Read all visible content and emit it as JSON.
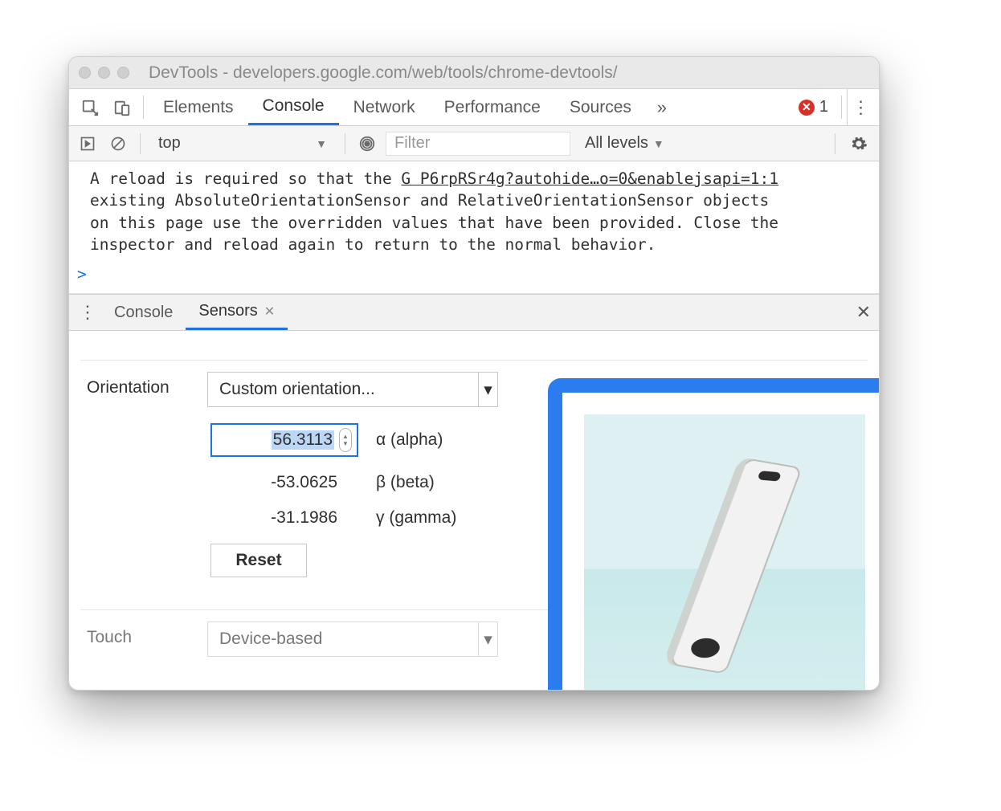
{
  "window": {
    "title": "DevTools - developers.google.com/web/tools/chrome-devtools/"
  },
  "tabstrip": {
    "tabs": [
      "Elements",
      "Console",
      "Network",
      "Performance",
      "Sources"
    ],
    "active": "Console",
    "more_glyph": "»",
    "error_count": "1"
  },
  "filterbar": {
    "context": "top",
    "filter_placeholder": "Filter",
    "levels_label": "All levels"
  },
  "console": {
    "message_pre": "A reload is required so that the ",
    "message_link": "G P6rpRSr4g?autohide…o=0&enablejsapi=1:1",
    "message_line2": "existing AbsoluteOrientationSensor and RelativeOrientationSensor objects",
    "message_line3": "on this page use the overridden values that have been provided. Close the",
    "message_line4": "inspector and reload again to return to the normal behavior.",
    "prompt": ">"
  },
  "drawer": {
    "tabs": {
      "console": "Console",
      "sensors": "Sensors"
    },
    "active": "Sensors"
  },
  "sensors": {
    "orientation_label": "Orientation",
    "orientation_select": "Custom orientation...",
    "alpha": {
      "value": "56.3113",
      "label": "α (alpha)"
    },
    "beta": {
      "value": "-53.0625",
      "label": "β (beta)"
    },
    "gamma": {
      "value": "-31.1986",
      "label": "γ (gamma)"
    },
    "reset_label": "Reset",
    "touch_label": "Touch",
    "touch_select": "Device-based"
  }
}
